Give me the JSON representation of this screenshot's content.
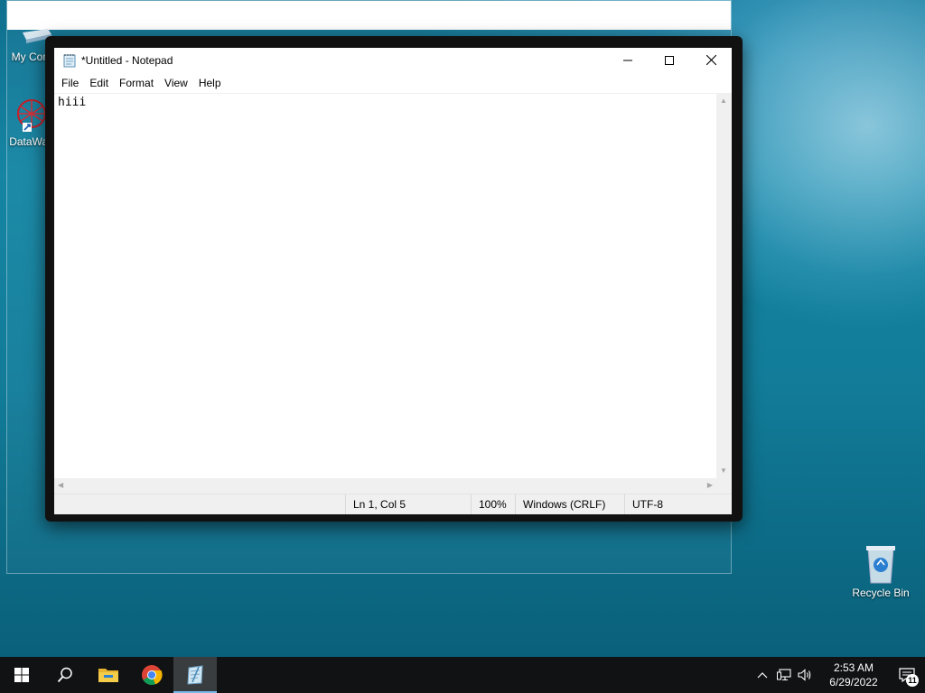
{
  "desktop": {
    "icons": [
      {
        "label": "My Com",
        "icon": "computer-icon"
      },
      {
        "label": "DataWag",
        "icon": "datawagon-shortcut-icon"
      },
      {
        "label": "Recycle Bin",
        "icon": "recycle-bin-icon"
      }
    ]
  },
  "notepad": {
    "title": "*Untitled - Notepad",
    "menu": [
      "File",
      "Edit",
      "Format",
      "View",
      "Help"
    ],
    "content": "hiii",
    "status": {
      "position": "Ln 1, Col 5",
      "zoom": "100%",
      "line_ending": "Windows (CRLF)",
      "encoding": "UTF-8"
    }
  },
  "taskbar": {
    "items": [
      "start-icon",
      "search-icon",
      "file-explorer-icon",
      "chrome-icon",
      "notepad-icon"
    ],
    "clock": {
      "time": "2:53 AM",
      "date": "6/29/2022"
    },
    "notification_count": "11"
  },
  "colors": {
    "taskbar_bg": "#101214",
    "accent": "#76b9ed",
    "window_frame": "#111111"
  }
}
